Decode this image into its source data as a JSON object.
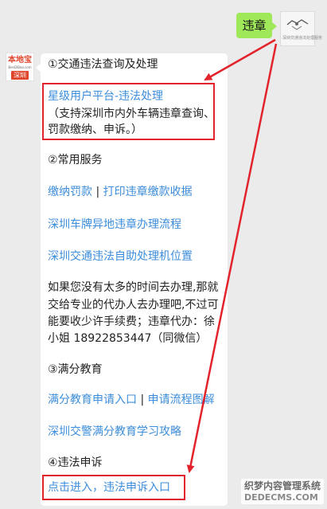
{
  "chat": {
    "outgoing_text": "违章",
    "user_avatar": {
      "caption": "深圳交通违法处理服务"
    },
    "bot_avatar": {
      "brand": "本地宝",
      "brand_sub": "BenDiBao.com",
      "city": "深圳"
    }
  },
  "reply": {
    "section1_header": "①交通违法查询及处理",
    "platform_link": "星级用户平台-违法处理",
    "platform_desc_line1": "（支持深圳市内外车辆违章查询、",
    "platform_desc_line2": "罚款缴纳、申诉。）",
    "section2_header": "②常用服务",
    "pay_fine_link": "缴纳罚款",
    "separator": "|",
    "print_receipt_link": "打印违章缴款收据",
    "offsite_process_link": "深圳车牌异地违章办理流程",
    "self_service_link": "深圳交通违法自助处理机位置",
    "agent_line1": "如果您没有太多的时间去办理,那就",
    "agent_line2": "交给专业的代办人去办理吧,不过可",
    "agent_line3": "能要收少许手续费；违章代办：徐",
    "agent_line4": "小姐 18922853447（同微信）",
    "section3_header": "③满分教育",
    "edu_apply_link": "满分教育申请入口",
    "edu_flow_link": "申请流程图解",
    "edu_guide_link": "深圳交警满分教育学习攻略",
    "section4_header": "④违法申诉",
    "appeal_link": "点击进入，违法申诉入口"
  },
  "watermark": {
    "line1": "织梦内容管理系统",
    "line2": "DEDECMS.COM"
  },
  "colors": {
    "background": "#ebebeb",
    "outgoing_bubble": "#9fe85a",
    "link": "#3c8ddb",
    "highlight": "#e3232b"
  }
}
